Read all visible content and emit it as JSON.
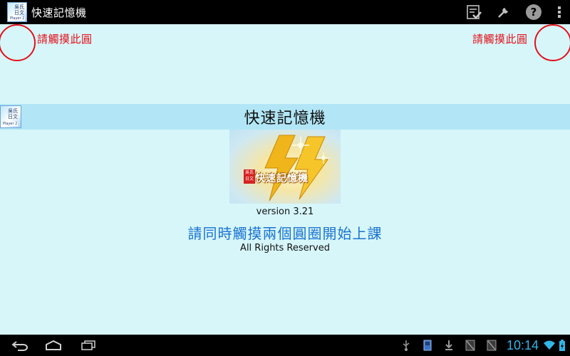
{
  "action_bar": {
    "app_title": "快速記憶機",
    "app_icon": {
      "glyphs": "吳氏日文",
      "badge": "Player 2"
    },
    "actions": [
      "checklist-icon",
      "wrench-icon",
      "help-icon",
      "overflow-menu-icon"
    ]
  },
  "touch_targets": {
    "left_label": "請觸摸此圓",
    "right_label": "請觸摸此圓",
    "color": "#e3111a"
  },
  "main": {
    "title": "快速記憶機",
    "logo": {
      "stamp": "吳氏日文",
      "text": "快速記憶機"
    },
    "version": "version 3.21",
    "instruction": "請同時觸摸兩個圓圈開始上課",
    "rights": "All Rights Reserved"
  },
  "system_bar": {
    "nav": [
      "back-icon",
      "home-icon",
      "recents-icon"
    ],
    "status": [
      "usb-icon",
      "sd-card-icon",
      "download-icon",
      "no-sim-icon",
      "no-sim-icon"
    ],
    "time": "10:14",
    "accent": "#33b5e5"
  }
}
